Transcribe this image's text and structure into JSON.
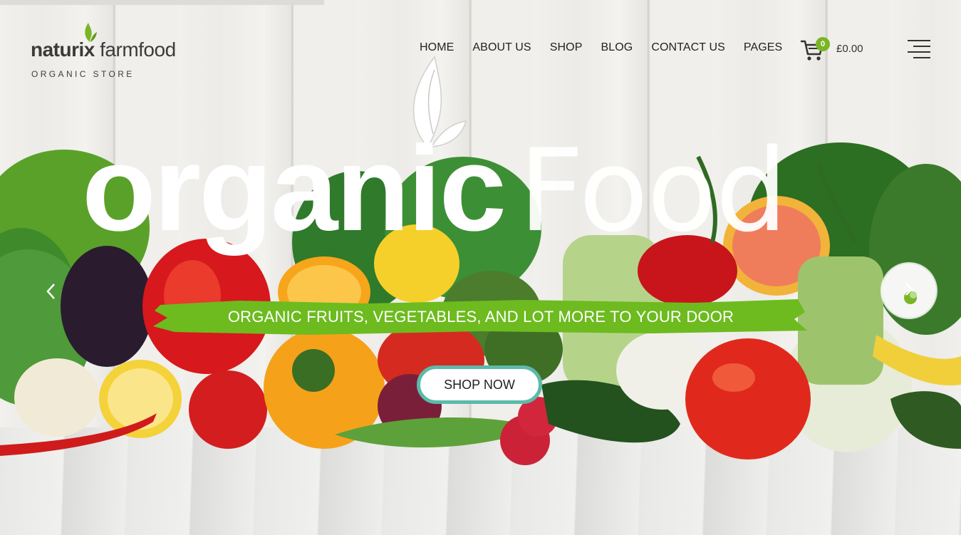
{
  "brand": {
    "name_bold": "naturix",
    "name_light": "farmfood",
    "tagline": "ORGANIC STORE",
    "accent_color": "#7ab526"
  },
  "nav": {
    "items": [
      {
        "label": "HOME"
      },
      {
        "label": "ABOUT US"
      },
      {
        "label": "SHOP"
      },
      {
        "label": "BLOG"
      },
      {
        "label": "CONTACT US"
      },
      {
        "label": "PAGES"
      }
    ]
  },
  "cart": {
    "count": "0",
    "total": "£0.00",
    "icon": "cart-icon"
  },
  "menu": {
    "icon": "hamburger-menu-icon"
  },
  "hero": {
    "headline_bold": "organic",
    "headline_light": "Food",
    "subtitle": "ORGANIC FRUITS, VEGETABLES, AND LOT MORE TO YOUR DOOR",
    "cta_label": "SHOP NOW",
    "banner_color": "#6dbb1f",
    "cta_border_color": "#5cbaa9",
    "prev_icon": "chevron-left-icon",
    "next_icon": "next-slide-thumbnail"
  }
}
